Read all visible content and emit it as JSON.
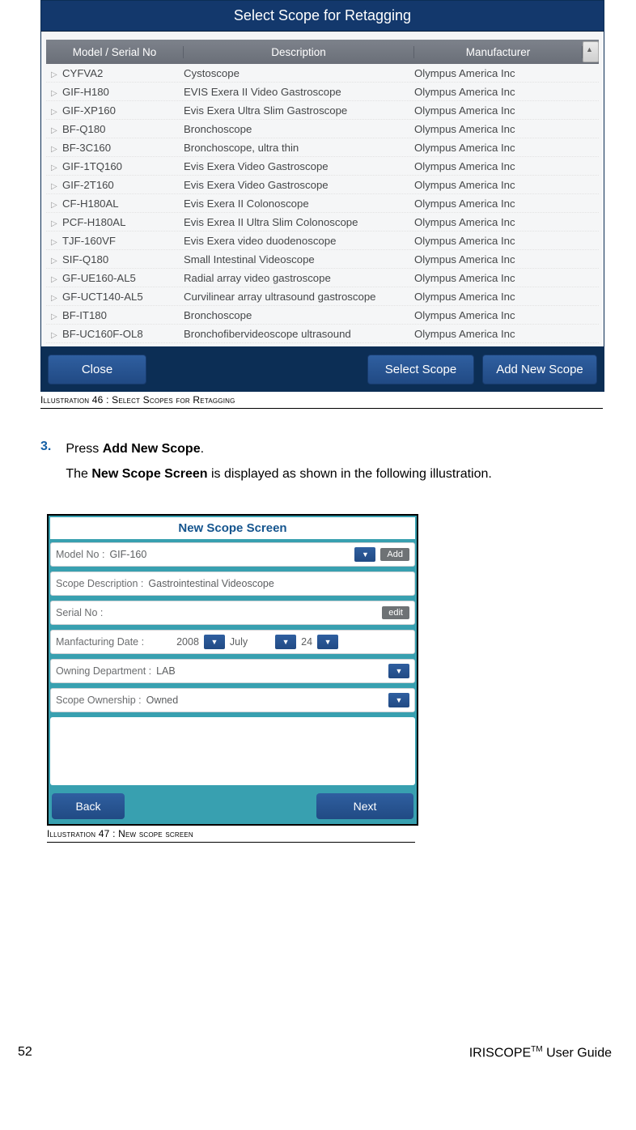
{
  "illus46": {
    "title": "Select Scope for Retagging",
    "headers": {
      "a": "Model / Serial No",
      "b": "Description",
      "c": "Manufacturer"
    },
    "rows": [
      {
        "a": "CYFVA2",
        "b": "Cystoscope",
        "c": "Olympus America Inc"
      },
      {
        "a": "GIF-H180",
        "b": "EVIS Exera II Video Gastroscope",
        "c": "Olympus America Inc"
      },
      {
        "a": "GIF-XP160",
        "b": "Evis Exera Ultra Slim Gastroscope",
        "c": "Olympus America Inc"
      },
      {
        "a": "BF-Q180",
        "b": "Bronchoscope",
        "c": "Olympus America Inc"
      },
      {
        "a": "BF-3C160",
        "b": "Bronchoscope, ultra thin",
        "c": "Olympus America Inc"
      },
      {
        "a": "GIF-1TQ160",
        "b": "Evis Exera Video Gastroscope",
        "c": "Olympus America Inc"
      },
      {
        "a": "GIF-2T160",
        "b": "Evis Exera Video Gastroscope",
        "c": "Olympus America Inc"
      },
      {
        "a": "CF-H180AL",
        "b": "Evis Exera II Colonoscope",
        "c": "Olympus America Inc"
      },
      {
        "a": "PCF-H180AL",
        "b": "Evis Exrea II Ultra Slim Colonoscope",
        "c": "Olympus America Inc"
      },
      {
        "a": "TJF-160VF",
        "b": "Evis Exera video duodenoscope",
        "c": "Olympus America Inc"
      },
      {
        "a": "SIF-Q180",
        "b": "Small Intestinal Videoscope",
        "c": "Olympus America Inc"
      },
      {
        "a": "GF-UE160-AL5",
        "b": "Radial array video gastroscope",
        "c": "Olympus America Inc"
      },
      {
        "a": "GF-UCT140-AL5",
        "b": "Curvilinear array ultrasound gastroscope",
        "c": "Olympus America Inc"
      },
      {
        "a": "BF-IT180",
        "b": "Bronchoscope",
        "c": "Olympus America Inc"
      },
      {
        "a": "BF-UC160F-OL8",
        "b": "Bronchofibervideoscope  ultrasound",
        "c": "Olympus America Inc"
      }
    ],
    "buttons": {
      "close": "Close",
      "select": "Select Scope",
      "addnew": "Add New Scope"
    },
    "caption": "Illustration 46 : Select Scopes for Retagging"
  },
  "step": {
    "num": "3.",
    "prefix": "Press ",
    "bold": "Add New Scope",
    "suffix": ".",
    "line2a": "The ",
    "line2b": "New Scope Screen",
    "line2c": " is displayed as shown in the following illustration."
  },
  "illus47": {
    "title": "New Scope Screen",
    "fields": {
      "modelLbl": "Model No :",
      "modelVal": "GIF-160",
      "addBtn": "Add",
      "descLbl": "Scope Description :",
      "descVal": "Gastrointestinal Videoscope",
      "serialLbl": "Serial No :",
      "editBtn": "edit",
      "mfgLbl": "Manfacturing Date :",
      "mfgYear": "2008",
      "mfgMonth": "July",
      "mfgDay": "24",
      "deptLbl": "Owning Department :",
      "deptVal": "LAB",
      "ownLbl": "Scope Ownership :",
      "ownVal": "Owned"
    },
    "buttons": {
      "back": "Back",
      "next": "Next"
    },
    "caption": "Illustration 47 : New scope screen"
  },
  "footer": {
    "page": "52",
    "guide_a": "IRISCOPE",
    "guide_b": " User Guide"
  }
}
